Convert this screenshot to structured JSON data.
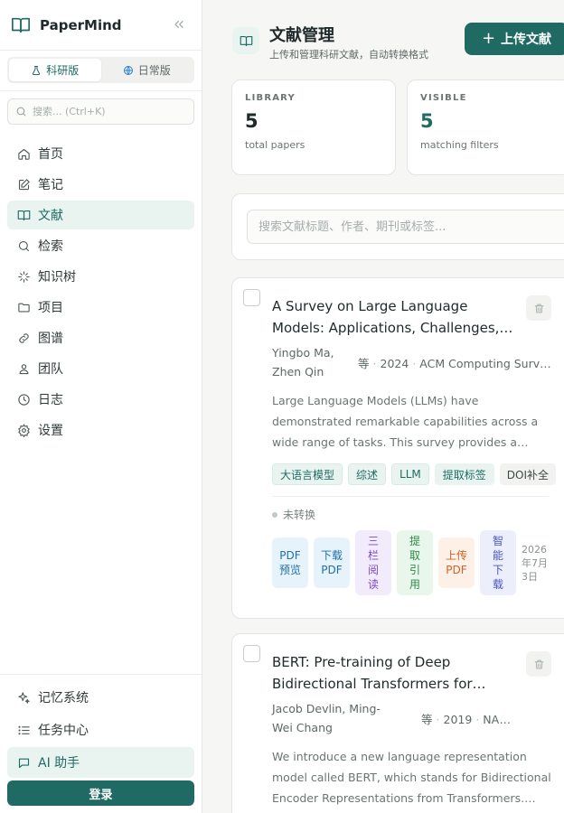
{
  "sidebar": {
    "brand": "PaperMind",
    "modes": [
      "科研版",
      "日常版"
    ],
    "search_placeholder": "搜索... (Ctrl+K)",
    "nav": [
      {
        "label": "首页",
        "icon": "home-icon"
      },
      {
        "label": "笔记",
        "icon": "edit-note-icon"
      },
      {
        "label": "文献",
        "icon": "book-open-icon"
      },
      {
        "label": "检索",
        "icon": "search-icon"
      },
      {
        "label": "知识树",
        "icon": "sparkle-tree-icon"
      },
      {
        "label": "项目",
        "icon": "folder-icon"
      },
      {
        "label": "图谱",
        "icon": "link-graph-icon"
      },
      {
        "label": "团队",
        "icon": "team-icon"
      },
      {
        "label": "日志",
        "icon": "clock-icon"
      },
      {
        "label": "设置",
        "icon": "settings-icon"
      }
    ],
    "active_nav": "文献",
    "bottom": [
      {
        "label": "记忆系统",
        "icon": "sparkles-icon"
      },
      {
        "label": "任务中心",
        "icon": "list-icon"
      },
      {
        "label": "AI 助手",
        "icon": "chat-icon"
      }
    ],
    "login_label": "登录"
  },
  "header": {
    "title": "文献管理",
    "subtitle": "上传和管理科研文献，自动转换格式",
    "upload_label": "上传文献"
  },
  "stats": [
    {
      "label": "LIBRARY",
      "value": "5",
      "desc": "total papers"
    },
    {
      "label": "VISIBLE",
      "value": "5",
      "desc": "matching filters"
    }
  ],
  "search": {
    "placeholder": "搜索文献标题、作者、期刊或标签..."
  },
  "papers": [
    {
      "title": "A Survey on Large Language Models: Applications, Challenges, Limitations, and Practical Usage",
      "authors": "Yingbo Ma, Zhen Qin",
      "etal": "等",
      "year": "2024",
      "venue": "ACM Computing Surveys",
      "abstract": "Large Language Models (LLMs) have demonstrated remarkable capabilities across a wide range of tasks. This survey provides a comprehensive overview of recent advances.",
      "tags": [
        "大语言模型",
        "综述",
        "LLM",
        "提取标签",
        "DOI补全"
      ],
      "status": "未转换",
      "actions": [
        {
          "label": "PDF预览",
          "color": "blue"
        },
        {
          "label": "下载PDF",
          "color": "blue"
        },
        {
          "label": "三栏阅读",
          "color": "purple"
        },
        {
          "label": "提取引用",
          "color": "green"
        },
        {
          "label": "上传PDF",
          "color": "orange"
        },
        {
          "label": "智能下载",
          "color": "indigo"
        }
      ],
      "date": "2026年7月3日"
    },
    {
      "title": "BERT: Pre-training of Deep Bidirectional Transformers for Language Understanding",
      "authors": "Jacob Devlin, Ming-Wei Chang",
      "etal": "等",
      "year": "2019",
      "venue": "NAACL",
      "abstract": "We introduce a new language representation model called BERT, which stands for Bidirectional Encoder Representations from Transformers. Unlike recent language representation models."
    }
  ]
}
